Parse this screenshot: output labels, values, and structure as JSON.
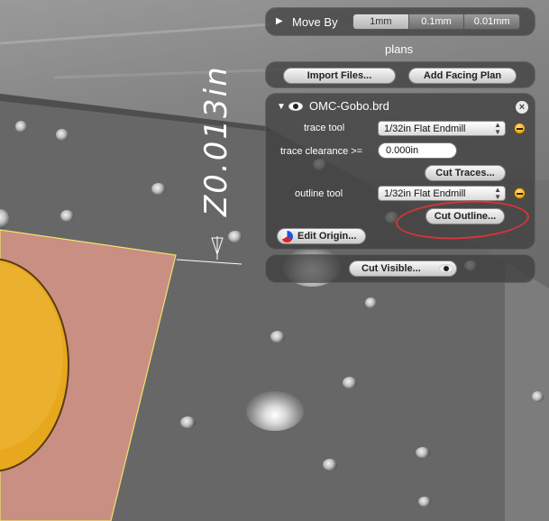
{
  "viewport": {
    "dimension_label": "Z0.013in"
  },
  "move_by": {
    "label": "Move By",
    "options": [
      "1mm",
      "0.1mm",
      "0.01mm"
    ],
    "selected": "1mm"
  },
  "plans": {
    "section_label": "plans",
    "import_button": "Import Files...",
    "facing_button": "Add Facing Plan"
  },
  "file_panel": {
    "filename": "OMC-Gobo.brd",
    "trace_tool_label": "trace tool",
    "trace_tool_value": "1/32in Flat Endmill",
    "trace_clearance_label": "trace clearance >=",
    "trace_clearance_value": "0.000in",
    "cut_traces_button": "Cut Traces...",
    "outline_tool_label": "outline tool",
    "outline_tool_value": "1/32in Flat Endmill",
    "cut_outline_button": "Cut Outline...",
    "edit_origin_button": "Edit Origin...",
    "close_glyph": "×"
  },
  "cut_visible": {
    "button": "Cut Visible..."
  },
  "colors": {
    "highlight_ellipse": "#d6343a",
    "pcb_copper": "#c98f83",
    "pad_gold": "#e8a81e",
    "panel_bg": "#3c3c3c"
  },
  "icons": {
    "disclosure": "triangle-right-icon",
    "disclosure_open": "triangle-down-icon",
    "visibility": "eye-icon",
    "close": "close-icon",
    "tool_info": "orange-minus-icon",
    "origin": "color-wheel-icon"
  }
}
